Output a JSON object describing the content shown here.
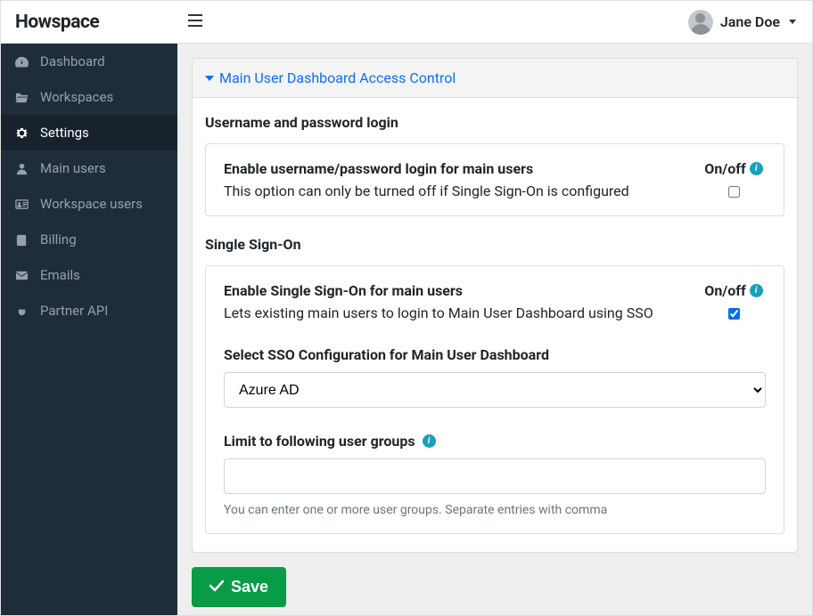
{
  "header": {
    "logo": "Howspace",
    "user_name": "Jane Doe"
  },
  "sidebar": {
    "items": [
      {
        "label": "Dashboard",
        "icon": "tachometer-icon"
      },
      {
        "label": "Workspaces",
        "icon": "folder-open-icon"
      },
      {
        "label": "Settings",
        "icon": "gear-icon",
        "active": true
      },
      {
        "label": "Main users",
        "icon": "user-icon"
      },
      {
        "label": "Workspace users",
        "icon": "address-card-icon"
      },
      {
        "label": "Billing",
        "icon": "book-icon"
      },
      {
        "label": "Emails",
        "icon": "envelope-icon"
      },
      {
        "label": "Partner API",
        "icon": "plug-icon"
      }
    ]
  },
  "accordion": {
    "title": "Main User Dashboard Access Control"
  },
  "section_userpass": {
    "heading": "Username and password login",
    "row_title": "Enable username/password login for main users",
    "row_desc": "This option can only be turned off if Single Sign-On is configured",
    "toggle_label": "On/off",
    "checked": false
  },
  "section_sso": {
    "heading": "Single Sign-On",
    "row_title": "Enable Single Sign-On for main users",
    "row_desc": "Lets existing main users to login to Main User Dashboard using SSO",
    "toggle_label": "On/off",
    "checked": true,
    "select_label": "Select SSO Configuration for Main User Dashboard",
    "select_value": "Azure AD",
    "groups_label": "Limit to following user groups",
    "groups_value": "",
    "groups_help": "You can enter one or more user groups. Separate entries with comma"
  },
  "save_label": "Save"
}
